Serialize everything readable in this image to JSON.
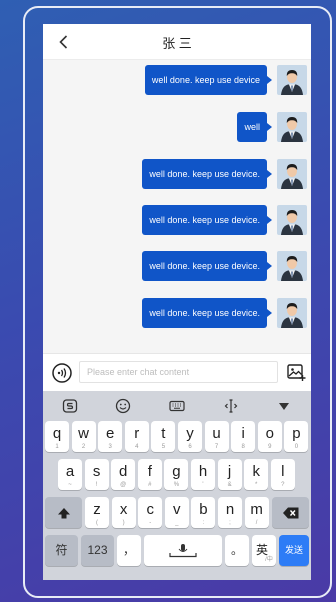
{
  "header": {
    "title": "张 三"
  },
  "messages": [
    {
      "text": "well done. keep use device"
    },
    {
      "text": "well"
    },
    {
      "text": "well done. keep use device."
    },
    {
      "text": "well done. keep use device."
    },
    {
      "text": "well done. keep use device."
    },
    {
      "text": "well done. keep use device."
    }
  ],
  "input": {
    "placeholder": "Please enter chat content",
    "value": ""
  },
  "keyboard": {
    "row1": [
      {
        "k": "q",
        "s": "1"
      },
      {
        "k": "w",
        "s": "2"
      },
      {
        "k": "e",
        "s": "3"
      },
      {
        "k": "r",
        "s": "4"
      },
      {
        "k": "t",
        "s": "5"
      },
      {
        "k": "y",
        "s": "6"
      },
      {
        "k": "u",
        "s": "7"
      },
      {
        "k": "i",
        "s": "8"
      },
      {
        "k": "o",
        "s": "9"
      },
      {
        "k": "p",
        "s": "0"
      }
    ],
    "row2": [
      {
        "k": "a",
        "s": "~"
      },
      {
        "k": "s",
        "s": "!"
      },
      {
        "k": "d",
        "s": "@"
      },
      {
        "k": "f",
        "s": "#"
      },
      {
        "k": "g",
        "s": "%"
      },
      {
        "k": "h",
        "s": "'"
      },
      {
        "k": "j",
        "s": "&"
      },
      {
        "k": "k",
        "s": "*"
      },
      {
        "k": "l",
        "s": "?"
      }
    ],
    "row3": [
      {
        "k": "z",
        "s": "("
      },
      {
        "k": "x",
        "s": ")"
      },
      {
        "k": "c",
        "s": "-"
      },
      {
        "k": "v",
        "s": "_"
      },
      {
        "k": "b",
        "s": ":"
      },
      {
        "k": "n",
        "s": ";"
      },
      {
        "k": "m",
        "s": "/"
      }
    ],
    "symbols": "符",
    "numbers": "123",
    "comma": "，",
    "period": "。",
    "lang": "英",
    "lang_sub": "/中",
    "send": "发送"
  },
  "colors": {
    "accent": "#1055c8",
    "send": "#2d7cf6"
  }
}
